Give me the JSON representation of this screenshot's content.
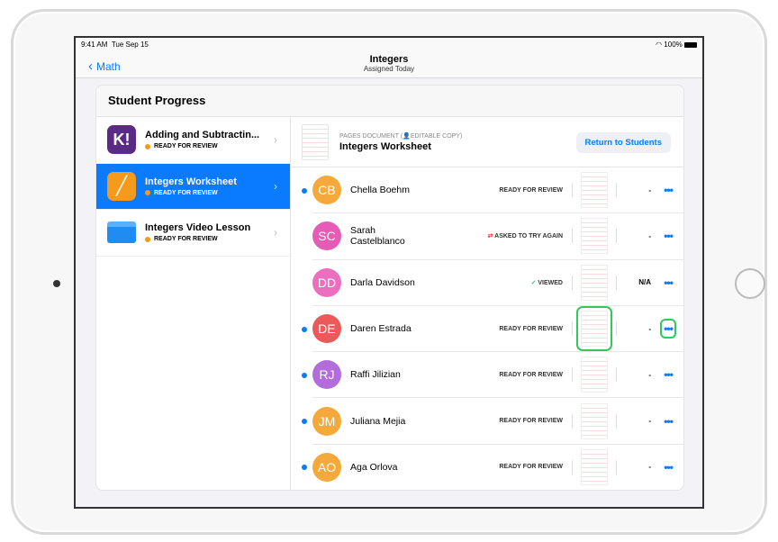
{
  "status": {
    "time": "9:41 AM",
    "date": "Tue Sep 15",
    "battery": "100%"
  },
  "nav": {
    "back": "Math",
    "title": "Integers",
    "subtitle": "Assigned Today"
  },
  "card_title": "Student Progress",
  "sidebar": [
    {
      "title": "Adding and Subtractin...",
      "status": "READY FOR REVIEW",
      "icon": "K!",
      "color": "#5b2a86"
    },
    {
      "title": "Integers Worksheet",
      "status": "READY FOR REVIEW",
      "icon": "pages",
      "color": "#f59a1b"
    },
    {
      "title": "Integers Video Lesson",
      "status": "READY FOR REVIEW",
      "icon": "folder",
      "color": "#1e90ff"
    }
  ],
  "doc": {
    "type": "PAGES DOCUMENT",
    "copy": "EDITABLE COPY",
    "name": "Integers Worksheet",
    "button": "Return to Students"
  },
  "students": [
    {
      "initials": "CB",
      "name": "Chella Boehm",
      "status": "READY FOR REVIEW",
      "score": "-",
      "unread": true,
      "color": "#f5a93b"
    },
    {
      "initials": "SC",
      "name": "Sarah Castelblanco",
      "status": "ASKED TO TRY AGAIN",
      "score": "-",
      "unread": false,
      "color": "#e65bb5"
    },
    {
      "initials": "DD",
      "name": "Darla Davidson",
      "status": "VIEWED",
      "score": "N/A",
      "unread": false,
      "color": "#ec6fbf"
    },
    {
      "initials": "DE",
      "name": "Daren Estrada",
      "status": "READY FOR REVIEW",
      "score": "-",
      "unread": true,
      "color": "#eb5a5a"
    },
    {
      "initials": "RJ",
      "name": "Raffi Jilizian",
      "status": "READY FOR REVIEW",
      "score": "-",
      "unread": true,
      "color": "#b26ddb"
    },
    {
      "initials": "JM",
      "name": "Juliana Mejia",
      "status": "READY FOR REVIEW",
      "score": "-",
      "unread": true,
      "color": "#f5a93b"
    },
    {
      "initials": "AO",
      "name": "Aga Orlova",
      "status": "READY FOR REVIEW",
      "score": "-",
      "unread": true,
      "color": "#f5a93b"
    }
  ]
}
